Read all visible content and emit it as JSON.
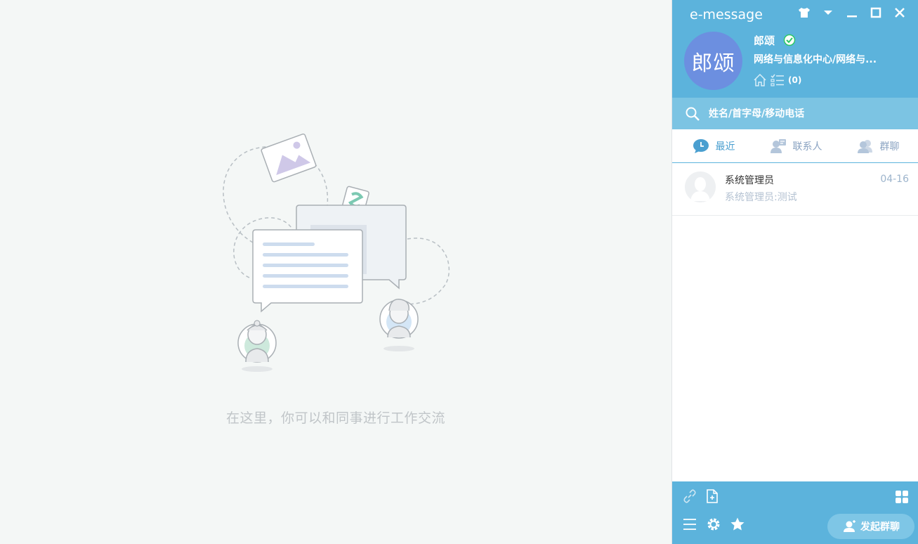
{
  "main": {
    "empty_text": "在这里，你可以和同事进行工作交流"
  },
  "header": {
    "app_title": "e-message",
    "window_controls": [
      "skin-icon",
      "dropdown-icon",
      "minimize-icon",
      "maximize-icon",
      "close-icon"
    ],
    "avatar_text": "郎颂",
    "user_name": "郎颂",
    "status": "online",
    "department": "网络与信息化中心/网络与...",
    "todo_count": "(0)"
  },
  "search": {
    "placeholder": "姓名/首字母/移动电话"
  },
  "tabs": [
    {
      "label": "最近",
      "icon": "recent-chat-icon",
      "active": true
    },
    {
      "label": "联系人",
      "icon": "contacts-icon",
      "active": false
    },
    {
      "label": "群聊",
      "icon": "group-icon",
      "active": false
    }
  ],
  "conversations": [
    {
      "name": "系统管理员",
      "date": "04-16",
      "preview": "系统管理员:测试"
    }
  ],
  "footer": {
    "group_chat_label": "发起群聊"
  },
  "colors": {
    "header_bg": "#5cb3dc",
    "search_bg": "#7cc4e3",
    "avatar_bg": "#6c8fe0",
    "active_tab": "#4a9fd0",
    "online_green": "#2ec866"
  }
}
